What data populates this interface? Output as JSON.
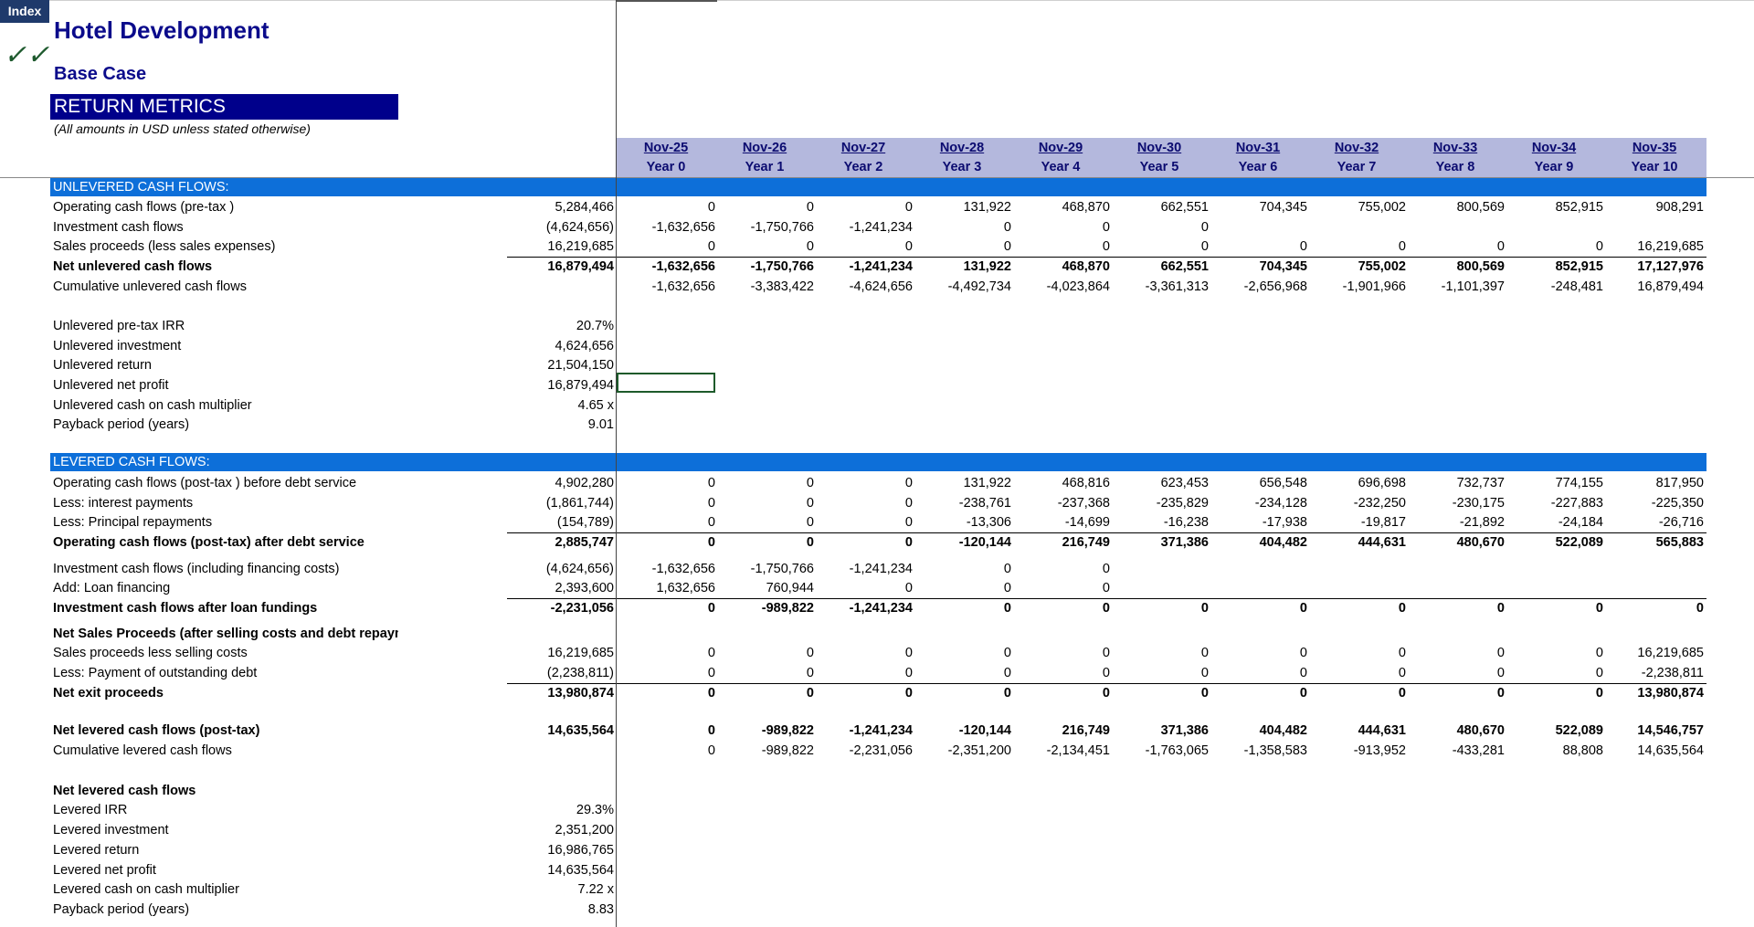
{
  "sheet": {
    "index_tab": "Index",
    "check_icon": "✓✓",
    "title": "Hotel Development",
    "subtitle": "Base Case",
    "section_title": "RETURN METRICS",
    "note": "(All amounts in USD unless stated otherwise)"
  },
  "columns": [
    {
      "date": "Nov-25",
      "year": "Year 0"
    },
    {
      "date": "Nov-26",
      "year": "Year 1"
    },
    {
      "date": "Nov-27",
      "year": "Year 2"
    },
    {
      "date": "Nov-28",
      "year": "Year 3"
    },
    {
      "date": "Nov-29",
      "year": "Year 4"
    },
    {
      "date": "Nov-30",
      "year": "Year 5"
    },
    {
      "date": "Nov-31",
      "year": "Year 6"
    },
    {
      "date": "Nov-32",
      "year": "Year 7"
    },
    {
      "date": "Nov-33",
      "year": "Year 8"
    },
    {
      "date": "Nov-34",
      "year": "Year 9"
    },
    {
      "date": "Nov-35",
      "year": "Year 10"
    }
  ],
  "unlevered_band": "UNLEVERED CASH FLOWS:",
  "levered_band": "LEVERED CASH FLOWS:",
  "rows": [
    {
      "label": "Operating cash flows (pre-tax )",
      "total": "5,284,466",
      "vals": [
        "0",
        "0",
        "0",
        "131,922",
        "468,870",
        "662,551",
        "704,345",
        "755,002",
        "800,569",
        "852,915",
        "908,291"
      ]
    },
    {
      "label": "Investment cash flows",
      "total": "(4,624,656)",
      "vals": [
        "-1,632,656",
        "-1,750,766",
        "-1,241,234",
        "0",
        "0",
        "0",
        "",
        "",
        "",
        "",
        ""
      ]
    },
    {
      "label": "Sales proceeds (less sales expenses)",
      "total": "16,219,685",
      "vals": [
        "0",
        "0",
        "0",
        "0",
        "0",
        "0",
        "0",
        "0",
        "0",
        "0",
        "16,219,685"
      ]
    },
    {
      "label": "Net unlevered cash flows",
      "total": "16,879,494",
      "bold": true,
      "vals": [
        "-1,632,656",
        "-1,750,766",
        "-1,241,234",
        "131,922",
        "468,870",
        "662,551",
        "704,345",
        "755,002",
        "800,569",
        "852,915",
        "17,127,976"
      ]
    },
    {
      "label": "Cumulative unlevered cash flows",
      "total": "",
      "vals": [
        "-1,632,656",
        "-3,383,422",
        "-4,624,656",
        "-4,492,734",
        "-4,023,864",
        "-3,361,313",
        "-2,656,968",
        "-1,901,966",
        "-1,101,397",
        "-248,481",
        "16,879,494"
      ]
    },
    {
      "label": "Unlevered pre-tax IRR",
      "total": "20.7%",
      "vals": []
    },
    {
      "label": "Unlevered investment",
      "total": "4,624,656",
      "vals": []
    },
    {
      "label": "Unlevered return",
      "total": "21,504,150",
      "vals": []
    },
    {
      "label": "Unlevered net profit",
      "total": "16,879,494",
      "vals": []
    },
    {
      "label": "Unlevered cash on cash multiplier",
      "total": "4.65 x",
      "vals": []
    },
    {
      "label": "Payback period (years)",
      "total": "9.01",
      "vals": []
    },
    {
      "label": "Operating cash flows (post-tax ) before debt service",
      "total": "4,902,280",
      "vals": [
        "0",
        "0",
        "0",
        "131,922",
        "468,816",
        "623,453",
        "656,548",
        "696,698",
        "732,737",
        "774,155",
        "817,950"
      ]
    },
    {
      "label": "Less: interest payments",
      "total": "(1,861,744)",
      "vals": [
        "0",
        "0",
        "0",
        "-238,761",
        "-237,368",
        "-235,829",
        "-234,128",
        "-232,250",
        "-230,175",
        "-227,883",
        "-225,350"
      ]
    },
    {
      "label": "Less: Principal repayments",
      "total": "(154,789)",
      "vals": [
        "0",
        "0",
        "0",
        "-13,306",
        "-14,699",
        "-16,238",
        "-17,938",
        "-19,817",
        "-21,892",
        "-24,184",
        "-26,716"
      ]
    },
    {
      "label": "Operating cash flows (post-tax) after debt service",
      "total": "2,885,747",
      "bold": true,
      "vals": [
        "0",
        "0",
        "0",
        "-120,144",
        "216,749",
        "371,386",
        "404,482",
        "444,631",
        "480,670",
        "522,089",
        "565,883"
      ]
    },
    {
      "label": "Investment cash flows (including financing costs)",
      "total": "(4,624,656)",
      "vals": [
        "-1,632,656",
        "-1,750,766",
        "-1,241,234",
        "0",
        "0",
        "",
        "",
        "",
        "",
        "",
        ""
      ]
    },
    {
      "label": "Add: Loan financing",
      "total": "2,393,600",
      "vals": [
        "1,632,656",
        "760,944",
        "0",
        "0",
        "0",
        "",
        "",
        "",
        "",
        "",
        ""
      ]
    },
    {
      "label": "Investment cash flows after loan fundings",
      "total": "-2,231,056",
      "bold": true,
      "vals": [
        "0",
        "-989,822",
        "-1,241,234",
        "0",
        "0",
        "0",
        "0",
        "0",
        "0",
        "0",
        "0"
      ]
    },
    {
      "label": "Net Sales Proceeds (after selling costs and debt repayment)",
      "total": "",
      "bold": true,
      "vals": []
    },
    {
      "label": "Sales proceeds less selling costs",
      "total": "16,219,685",
      "vals": [
        "0",
        "0",
        "0",
        "0",
        "0",
        "0",
        "0",
        "0",
        "0",
        "0",
        "16,219,685"
      ]
    },
    {
      "label": "Less: Payment of outstanding debt",
      "total": "(2,238,811)",
      "vals": [
        "0",
        "0",
        "0",
        "0",
        "0",
        "0",
        "0",
        "0",
        "0",
        "0",
        "-2,238,811"
      ]
    },
    {
      "label": "Net exit proceeds",
      "total": "13,980,874",
      "bold": true,
      "vals": [
        "0",
        "0",
        "0",
        "0",
        "0",
        "0",
        "0",
        "0",
        "0",
        "0",
        "13,980,874"
      ]
    },
    {
      "label": "Net levered cash flows (post-tax)",
      "total": "14,635,564",
      "bold": true,
      "vals": [
        "0",
        "-989,822",
        "-1,241,234",
        "-120,144",
        "216,749",
        "371,386",
        "404,482",
        "444,631",
        "480,670",
        "522,089",
        "14,546,757"
      ]
    },
    {
      "label": "Cumulative levered cash flows",
      "total": "",
      "vals": [
        "0",
        "-989,822",
        "-2,231,056",
        "-2,351,200",
        "-2,134,451",
        "-1,763,065",
        "-1,358,583",
        "-913,952",
        "-433,281",
        "88,808",
        "14,635,564"
      ]
    },
    {
      "label": "Net levered cash flows",
      "total": "",
      "bold": true,
      "vals": []
    },
    {
      "label": "Levered IRR",
      "total": "29.3%",
      "vals": []
    },
    {
      "label": "Levered investment",
      "total": "2,351,200",
      "vals": []
    },
    {
      "label": "Levered return",
      "total": "16,986,765",
      "vals": []
    },
    {
      "label": "Levered net profit",
      "total": "14,635,564",
      "vals": []
    },
    {
      "label": "Levered cash on cash multiplier",
      "total": "7.22 x",
      "vals": []
    },
    {
      "label": "Payback period (years)",
      "total": "8.83",
      "vals": []
    }
  ]
}
